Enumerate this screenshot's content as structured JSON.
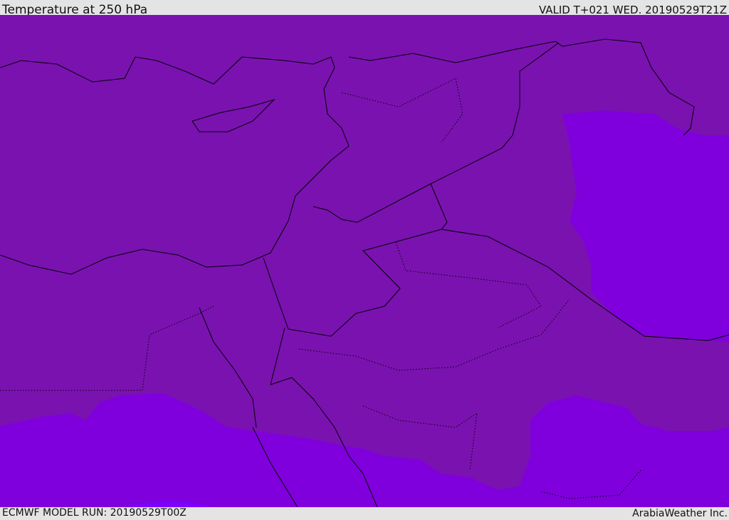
{
  "header": {
    "title": "Temperature at 250 hPa",
    "valid": "VALID T+021 WED. 20190529T21Z"
  },
  "footer": {
    "model_run": "ECMWF MODEL RUN: 20190529T00Z",
    "credit": "ArabiaWeather Inc."
  },
  "colors": {
    "base": "#7a12b0",
    "warmer": "#7f00dc",
    "warmest": "#7a00ff",
    "border": "#000000"
  }
}
